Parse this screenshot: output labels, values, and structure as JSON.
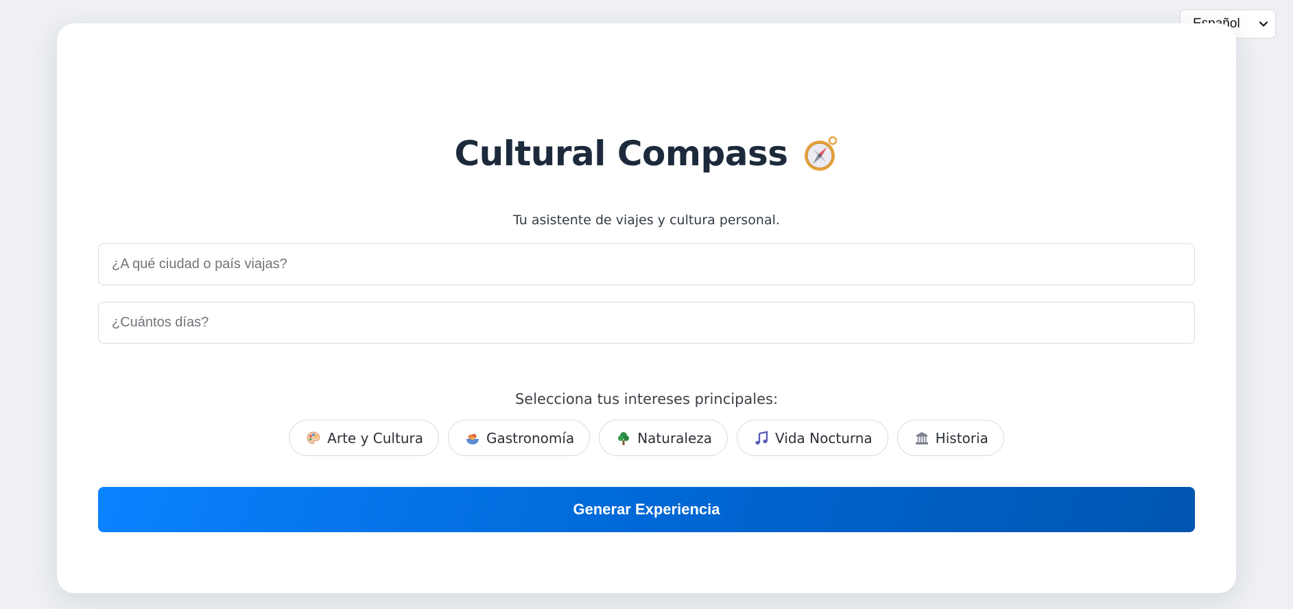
{
  "language_select": {
    "selected": "Español",
    "icon": "chevron-down-icon"
  },
  "header": {
    "title": "Cultural Compass",
    "title_icon": "compass-icon",
    "subtitle": "Tu asistente de viajes y cultura personal."
  },
  "form": {
    "city_placeholder": "¿A qué ciudad o país viajas?",
    "city_value": "",
    "days_placeholder": "¿Cuántos días?",
    "days_value": ""
  },
  "interests": {
    "label": "Selecciona tus intereses principales:",
    "items": [
      {
        "label": "Arte y Cultura",
        "icon": "palette-icon"
      },
      {
        "label": "Gastronomía",
        "icon": "food-icon"
      },
      {
        "label": "Naturaleza",
        "icon": "tree-icon"
      },
      {
        "label": "Vida Nocturna",
        "icon": "music-note-icon"
      },
      {
        "label": "Historia",
        "icon": "classical-building-icon"
      }
    ]
  },
  "actions": {
    "generate_label": "Generar Experiencia"
  },
  "colors": {
    "page_background": "#eef0f4",
    "card_background": "#ffffff",
    "title": "#1c2a3b",
    "button_start": "#0a82ff",
    "button_end": "#0055b0"
  }
}
